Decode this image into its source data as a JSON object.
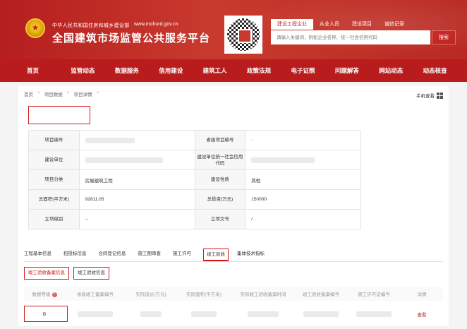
{
  "header": {
    "ministry": "中华人民共和国住房和城乡建设部",
    "url": "www.mohurd.gov.cn",
    "title": "全国建筑市场监管公共服务平台",
    "search_tabs": [
      "建设工程企业",
      "从业人员",
      "建设项目",
      "诚信记录"
    ],
    "search_placeholder": "请输入关键词，例如企业名称、统一社会信用代码",
    "search_button": "搜索"
  },
  "nav": [
    "首页",
    "监管动态",
    "数据服务",
    "信用建设",
    "建筑工人",
    "政策法规",
    "电子证照",
    "问题解答",
    "网站动态",
    "动态核查"
  ],
  "breadcrumb": [
    "首页",
    "项目数据",
    "项目详情"
  ],
  "manual": "手机查看",
  "info": {
    "project_no": "项目编号",
    "prov_project_no": "省级项目编号",
    "prov_project_no_val": "-",
    "build_unit": "建设单位",
    "credit_code": "建设单位统一社会信用代码",
    "category": "项目分类",
    "category_val": "房屋建筑工程",
    "nature": "建设性质",
    "nature_val": "其他",
    "area": "总面积(平方米)",
    "area_val": "92811.05",
    "investment": "总投资(万元)",
    "investment_val": "150000",
    "level": "立项级别",
    "level_val": "--",
    "doc_no": "立项文号",
    "doc_no_val": "/"
  },
  "tabs": [
    "工程基本信息",
    "招投标信息",
    "合同登记信息",
    "施工图审查",
    "施工许可",
    "竣工验收",
    "集体技术指标"
  ],
  "subtabs": [
    "竣工验收备案信息",
    "竣工验收信息"
  ],
  "table": {
    "headers": [
      "数据等级",
      "省级竣工备案编号",
      "实际造价(万元)",
      "实际面积(平方米)",
      "实际竣工验收备案时间",
      "竣工验收备案编号",
      "施工许可证编号",
      "详情"
    ],
    "row": {
      "level": "B",
      "view": "查看"
    }
  }
}
